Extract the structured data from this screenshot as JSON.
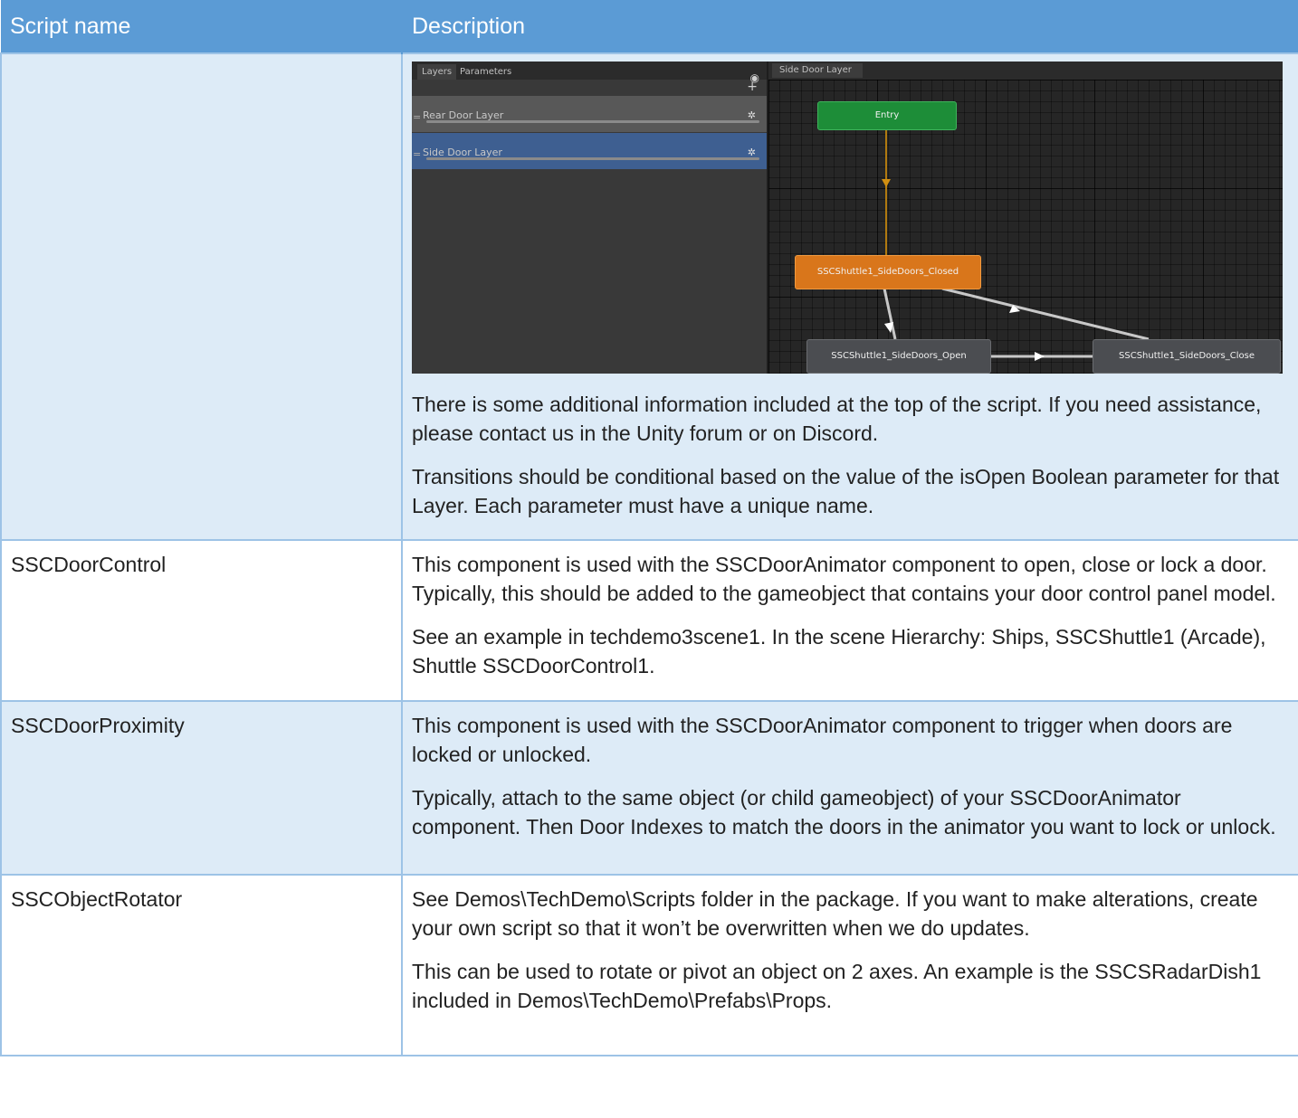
{
  "table": {
    "headers": [
      "Script name",
      "Description"
    ],
    "intro_row": {
      "paragraphs": [
        "There is some additional information included at the top of the script. If you need assistance, please contact us in the Unity forum or on Discord.",
        "Transitions should be conditional based on the value of the isOpen Boolean parameter for that Layer. Each parameter must have a unique name."
      ]
    },
    "rows": [
      {
        "name": "SSCDoorControl",
        "paragraphs": [
          "This component is used with the SSCDoorAnimator component to open, close or lock a door. Typically, this should be added to the gameobject that contains your door control panel model.",
          "See an example in techdemo3scene1. In the scene Hierarchy: Ships, SSCShuttle1 (Arcade), Shuttle SSCDoorControl1."
        ]
      },
      {
        "name": "SSCDoorProximity",
        "paragraphs": [
          "This component is used with the SSCDoorAnimator component to trigger when doors are locked or unlocked.",
          "Typically, attach to the same object (or child gameobject) of your SSCDoorAnimator component. Then Door Indexes to match the doors in the animator you want to lock or unlock."
        ]
      },
      {
        "name": "SSCObjectRotator",
        "paragraphs": [
          "See Demos\\TechDemo\\Scripts folder in the package. If you want to make alterations, create your own script so that it won’t be overwritten when we do updates.",
          "This can be used to rotate or pivot an object on 2 axes. An example is the SSCSRadarDish1 included in Demos\\TechDemo\\Prefabs\\Props."
        ]
      }
    ]
  },
  "animator": {
    "tabs": [
      "Layers",
      "Parameters"
    ],
    "layers": [
      "Rear Door Layer",
      "Side Door Layer"
    ],
    "breadcrumb": "Side Door Layer",
    "nodes": {
      "entry": "Entry",
      "closed": "SSCShuttle1_SideDoors_Closed",
      "open": "SSCShuttle1_SideDoors_Open",
      "close": "SSCShuttle1_SideDoors_Close"
    },
    "colors": {
      "entry": "#1d8d38",
      "default_state": "#d9761b",
      "state": "#4b4d51",
      "selected_layer": "#3e5f91"
    },
    "icons": [
      "eye-icon",
      "plus-icon",
      "gear-icon",
      "drag-handle-icon"
    ]
  }
}
